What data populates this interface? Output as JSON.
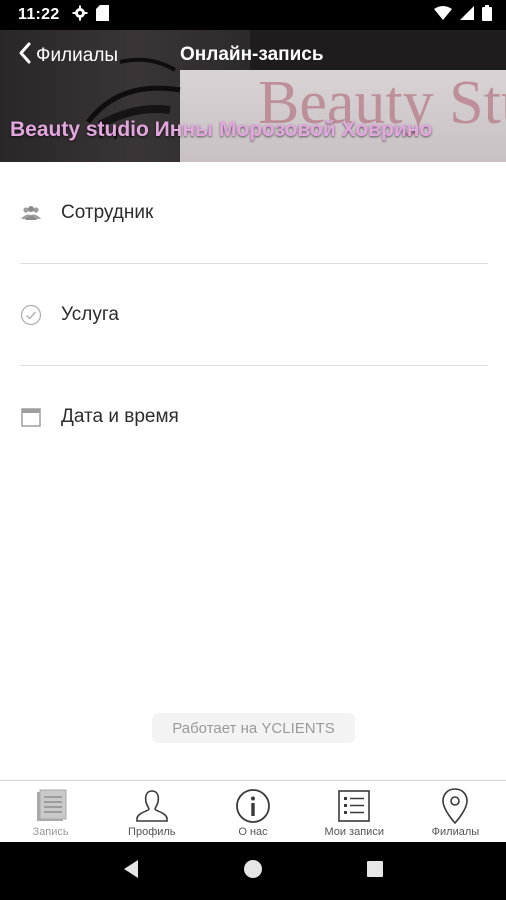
{
  "status_bar": {
    "time": "11:22"
  },
  "header": {
    "back_label": "Филиалы",
    "title": "Онлайн-запись",
    "banner_text": "Beauty Stu",
    "studio_name": "Beauty studio Инны Морозовой Ховрино"
  },
  "menu": {
    "items": [
      {
        "label": "Сотрудник",
        "icon": "people-icon"
      },
      {
        "label": "Услуга",
        "icon": "check-circle-icon"
      },
      {
        "label": "Дата и время",
        "icon": "calendar-icon"
      }
    ]
  },
  "powered_by": "Работает на YCLIENTS",
  "tabbar": {
    "tabs": [
      {
        "label": "Запись",
        "icon": "booking-icon",
        "active": true
      },
      {
        "label": "Профиль",
        "icon": "profile-icon",
        "active": false
      },
      {
        "label": "О нас",
        "icon": "info-icon",
        "active": false
      },
      {
        "label": "Мои записи",
        "icon": "list-icon",
        "active": false
      },
      {
        "label": "Филиалы",
        "icon": "location-pin-icon",
        "active": false
      }
    ]
  },
  "colors": {
    "studio_name": "#e3a6df",
    "header_bg": "#1f1c1d",
    "banner_word": "#b98590"
  }
}
